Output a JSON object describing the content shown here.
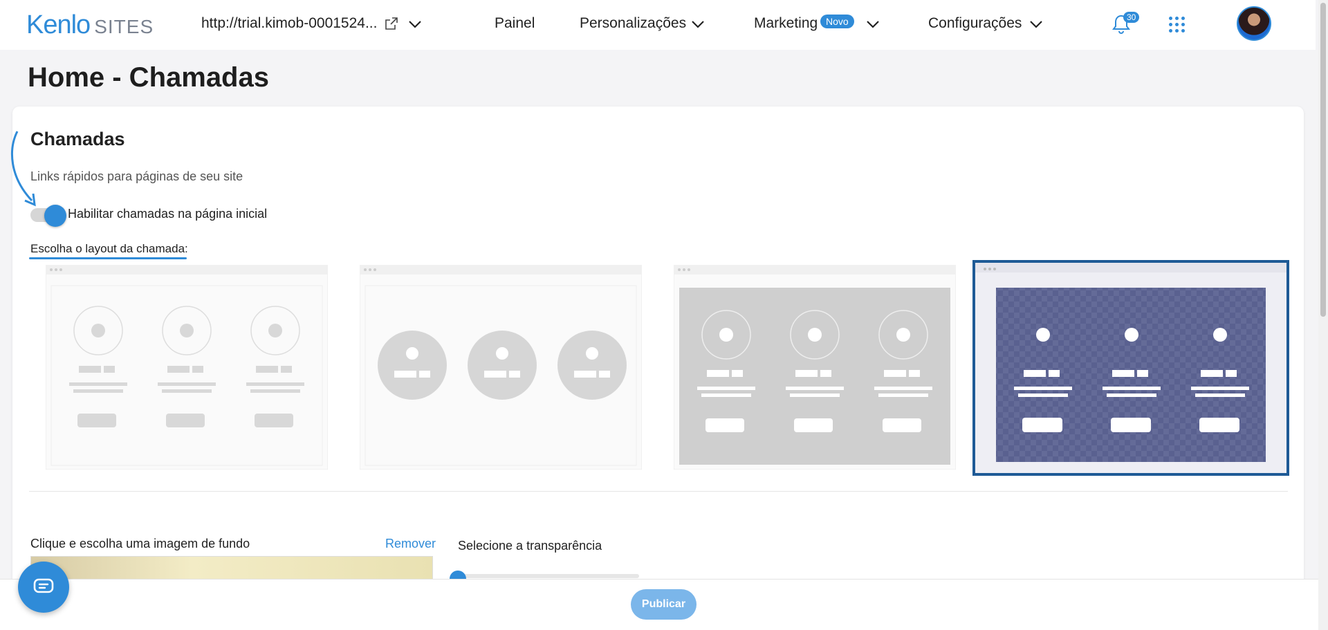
{
  "header": {
    "logo_main": "Kenlo",
    "logo_sub": "SITES",
    "url": "http://trial.kimob-0001524...",
    "nav": {
      "painel": "Painel",
      "personalizacoes": "Personalizações",
      "marketing": "Marketing",
      "marketing_badge": "Novo",
      "configuracoes": "Configurações"
    },
    "notifications_count": "30"
  },
  "page": {
    "title": "Home - Chamadas"
  },
  "section": {
    "title": "Chamadas",
    "subtitle": "Links rápidos para páginas de seu site",
    "toggle_label": "Habilitar chamadas na página inicial",
    "toggle_on": true,
    "layout_label": "Escolha o layout da chamada:",
    "layouts": [
      {
        "name": "layout-1",
        "selected": false
      },
      {
        "name": "layout-2",
        "selected": false
      },
      {
        "name": "layout-3",
        "selected": false
      },
      {
        "name": "layout-4",
        "selected": true
      }
    ],
    "background_label": "Clique e escolha uma imagem de fundo",
    "remove_label": "Remover",
    "transparency_label": "Selecione a transparência",
    "transparency_value": 0
  },
  "footer": {
    "publish_label": "Publicar"
  },
  "colors": {
    "accent": "#2f8bd8",
    "selected_outline": "#1e5a96",
    "layout4_bg": "#5a6190"
  }
}
